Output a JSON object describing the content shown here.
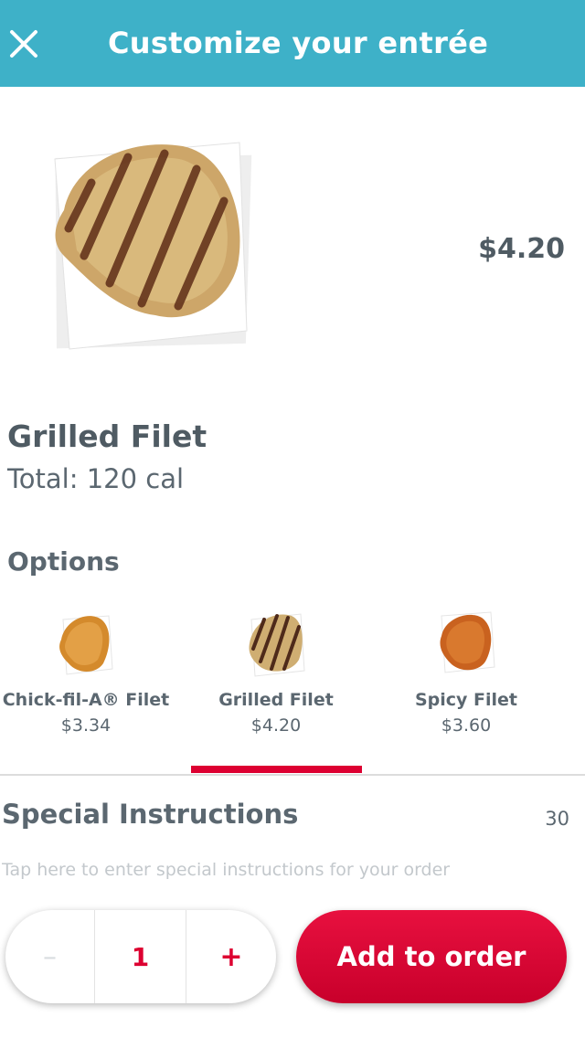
{
  "header": {
    "title": "Customize your entrée",
    "close_icon": "close-icon"
  },
  "item": {
    "image_icon": "grilled-filet-image",
    "price": "$4.20",
    "name": "Grilled Filet",
    "calories": "Total: 120 cal"
  },
  "options": {
    "heading": "Options",
    "selected_index": 1,
    "items": [
      {
        "name": "Chick-fil-A® Filet",
        "price": "$3.34",
        "icon": "chick-fil-a-filet-image"
      },
      {
        "name": "Grilled Filet",
        "price": "$4.20",
        "icon": "grilled-filet-image"
      },
      {
        "name": "Spicy Filet",
        "price": "$3.60",
        "icon": "spicy-filet-image"
      }
    ]
  },
  "special_instructions": {
    "heading": "Special Instructions",
    "char_count": "30",
    "placeholder": "Tap here to enter special instructions for your order"
  },
  "order": {
    "decrement_label": "–",
    "quantity": "1",
    "increment_label": "+",
    "add_label": "Add to order"
  },
  "colors": {
    "header_bg": "#3eb1c8",
    "accent_red": "#dd0031",
    "text": "#5b6770"
  }
}
